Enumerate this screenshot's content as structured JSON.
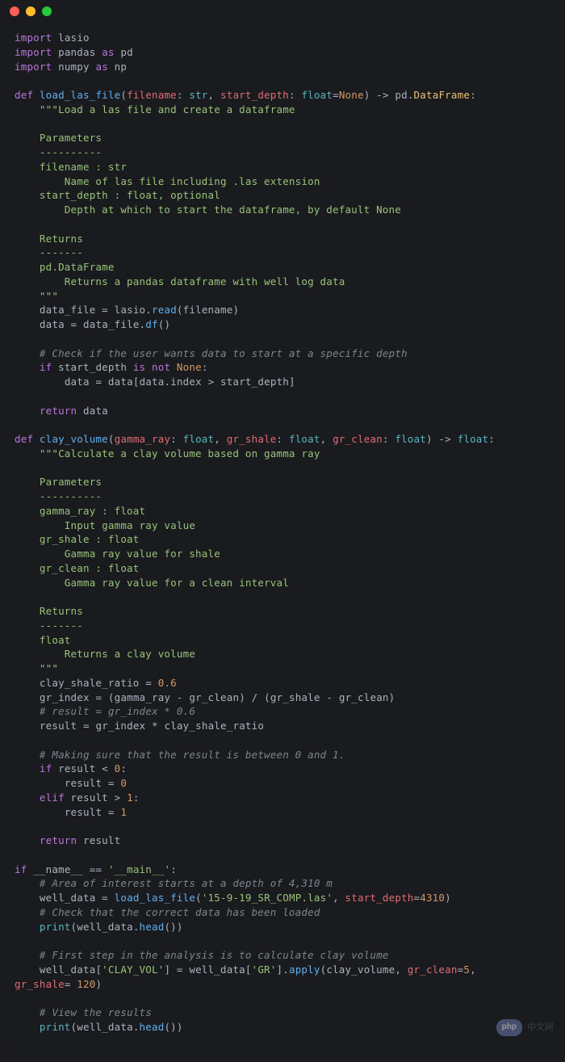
{
  "titlebar": {
    "buttons": [
      "close",
      "minimize",
      "maximize"
    ]
  },
  "code": {
    "l1_import": "import",
    "l1_mod": "lasio",
    "l2_import": "import",
    "l2_mod": "pandas",
    "l2_as": "as",
    "l2_alias": "pd",
    "l3_import": "import",
    "l3_mod": "numpy",
    "l3_as": "as",
    "l3_alias": "np",
    "def1": "def",
    "fn1": "load_las_file",
    "p1a": "filename",
    "t_str": "str",
    "p1b": "start_depth",
    "t_float": "float",
    "none": "None",
    "ret1": "pd",
    "ret1b": "DataFrame",
    "doc1a": "\"\"\"Load a las file and create a dataframe",
    "doc1b": "    Parameters",
    "doc1c": "    ----------",
    "doc1d": "    filename : str",
    "doc1e": "        Name of las file including .las extension",
    "doc1f": "    start_depth : float, optional",
    "doc1g": "        Depth at which to start the dataframe, by default None",
    "doc1h": "    Returns",
    "doc1i": "    -------",
    "doc1j": "    pd.DataFrame",
    "doc1k": "        Returns a pandas dataframe with well log data",
    "doc1l": "    \"\"\"",
    "a1_var": "data_file",
    "a1_mod": "lasio",
    "a1_fn": "read",
    "a1_arg": "filename",
    "a2_var": "data",
    "a2_src": "data_file",
    "a2_fn": "df",
    "cmt1": "# Check if the user wants data to start at a specific depth",
    "if1": "if",
    "if1_var": "start_depth",
    "isnot": "is not",
    "a3_var": "data",
    "a3_src": "data",
    "a3_idx": "data",
    "a3_prop": "index",
    "a3_cmp": "start_depth",
    "ret_kw": "return",
    "ret_var": "data",
    "def2": "def",
    "fn2": "clay_volume",
    "p2a": "gamma_ray",
    "p2b": "gr_shale",
    "p2c": "gr_clean",
    "doc2a": "\"\"\"Calculate a clay volume based on gamma ray",
    "doc2b": "    Parameters",
    "doc2c": "    ----------",
    "doc2d": "    gamma_ray : float",
    "doc2e": "        Input gamma ray value",
    "doc2f": "    gr_shale : float",
    "doc2g": "        Gamma ray value for shale",
    "doc2h": "    gr_clean : float",
    "doc2i": "        Gamma ray value for a clean interval",
    "doc2j": "    Returns",
    "doc2k": "    -------",
    "doc2l": "    float",
    "doc2m": "        Returns a clay volume",
    "doc2n": "    \"\"\"",
    "b1_var": "clay_shale_ratio",
    "b1_val": "0.6",
    "b2_var": "gr_index",
    "b2_a": "gamma_ray",
    "b2_b": "gr_clean",
    "b2_c": "gr_shale",
    "b2_d": "gr_clean",
    "cmt2": "# result = gr_index * 0.6",
    "b3_var": "result",
    "b3_a": "gr_index",
    "b3_b": "clay_shale_ratio",
    "cmt3": "# Making sure that the result is between 0 and 1.",
    "if2": "if",
    "if2_var": "result",
    "zero": "0",
    "b4_var": "result",
    "elif": "elif",
    "if3_var": "result",
    "one": "1",
    "b5_var": "result",
    "ret2_var": "result",
    "if_main": "if",
    "name_dunder": "__name__",
    "main_str": "'__main__'",
    "cmt4": "# Area of interest starts at a depth of 4,310 m",
    "c1_var": "well_data",
    "c1_fn": "load_las_file",
    "c1_str": "'15-9-19_SR_COMP.las'",
    "c1_kw": "start_depth",
    "c1_val": "4310",
    "cmt5": "# Check that the correct data has been loaded",
    "print": "print",
    "c2_var": "well_data",
    "head": "head",
    "cmt6": "# First step in the analysis is to calculate clay volume",
    "c3_var": "well_data",
    "c3_key": "'CLAY_VOL'",
    "c3_src": "well_data",
    "c3_key2": "'GR'",
    "apply": "apply",
    "c3_fn": "clay_volume",
    "c3_kw1": "gr_clean",
    "c3_v1": "5",
    "c3_kw2": "gr_shale",
    "c3_v2": "120",
    "cmt7": "# View the results",
    "c4_var": "well_data"
  },
  "watermark": {
    "badge": "php",
    "text": "中文网"
  }
}
